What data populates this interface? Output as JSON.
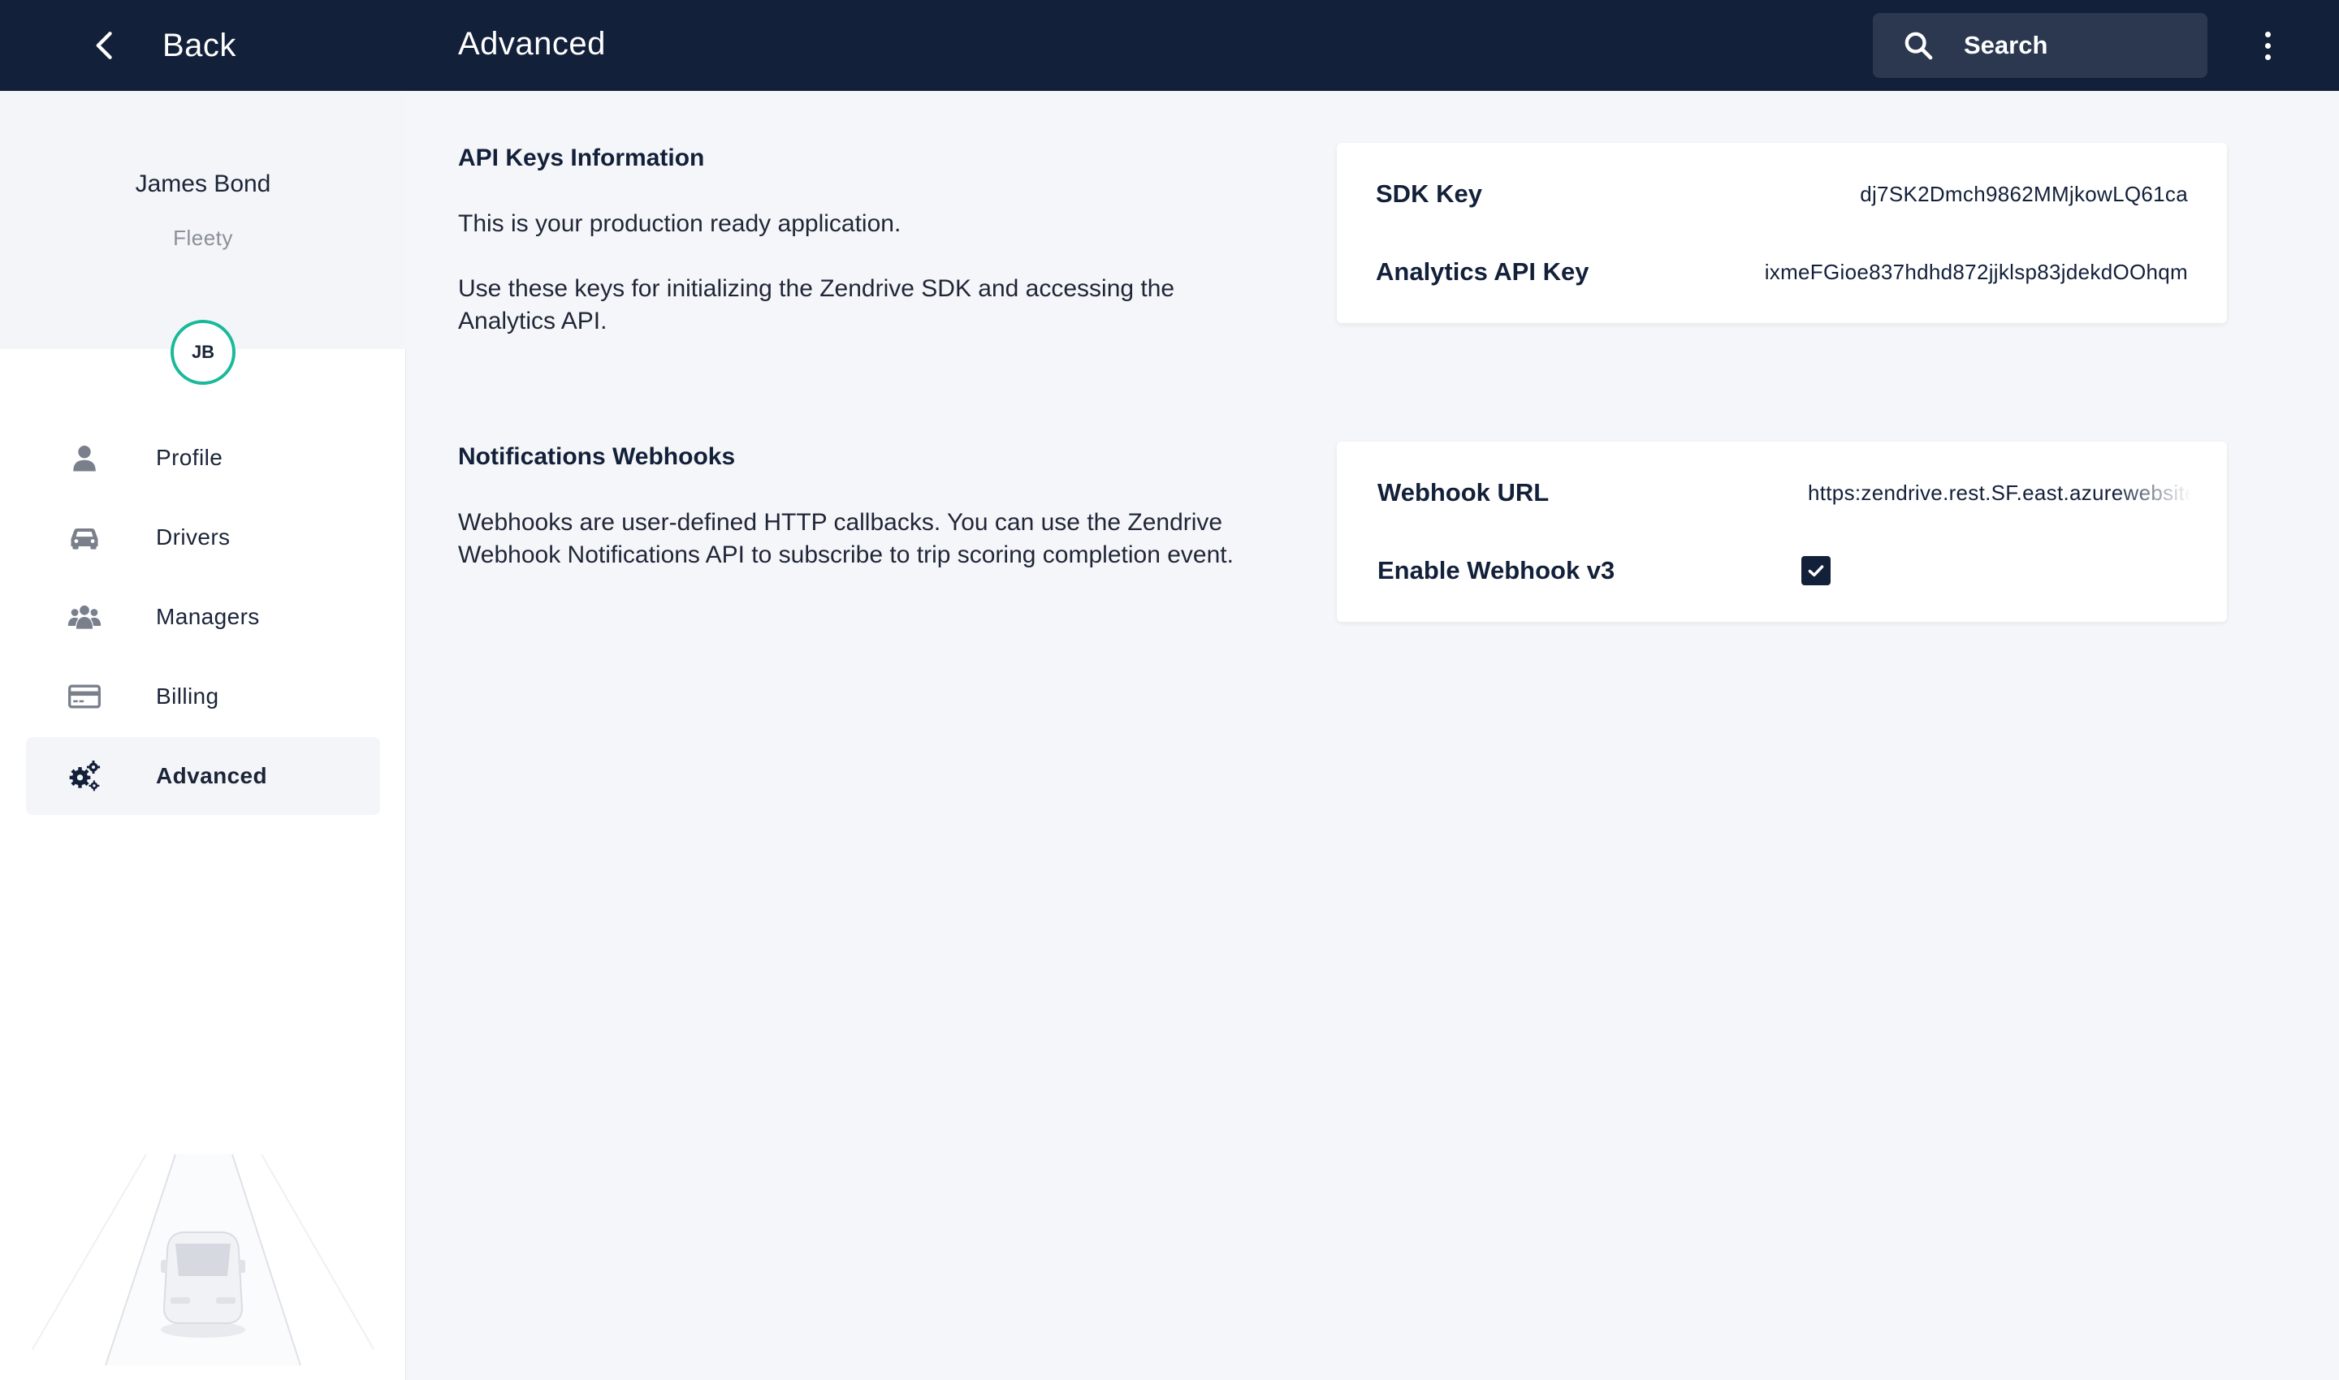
{
  "topbar": {
    "back_label": "Back",
    "page_title": "Advanced",
    "search_placeholder": "Search"
  },
  "sidebar": {
    "user_name": "James Bond",
    "org_name": "Fleety",
    "avatar_initials": "JB",
    "items": [
      {
        "label": "Profile",
        "icon": "user-icon",
        "active": false
      },
      {
        "label": "Drivers",
        "icon": "car-icon",
        "active": false
      },
      {
        "label": "Managers",
        "icon": "group-icon",
        "active": false
      },
      {
        "label": "Billing",
        "icon": "credit-card-icon",
        "active": false
      },
      {
        "label": "Advanced",
        "icon": "gears-icon",
        "active": true
      }
    ]
  },
  "api_keys": {
    "title": "API Keys Information",
    "text1": "This is your production ready application.",
    "text2": "Use these keys for initializing the Zendrive SDK and accessing the Analytics API.",
    "sdk_key_label": "SDK Key",
    "sdk_key_value": "dj7SK2Dmch9862MMjkowLQ61ca",
    "analytics_key_label": "Analytics API Key",
    "analytics_key_value": "ixmeFGioe837hdhd872jjklsp83jdekdOOhqm"
  },
  "webhooks": {
    "title": "Notifications Webhooks",
    "text": "Webhooks are user-defined HTTP callbacks. You can use the Zendrive Webhook Notifications API to subscribe to trip scoring completion event.",
    "url_label": "Webhook URL",
    "url_value": "https:zendrive.rest.SF.east.azurewebsites.net",
    "enable_v3_label": "Enable Webhook v3",
    "enable_v3_checked": true
  },
  "colors": {
    "topbar": "#13203a",
    "accent_avatar": "#1ab99a",
    "background": "#f5f6f9"
  }
}
